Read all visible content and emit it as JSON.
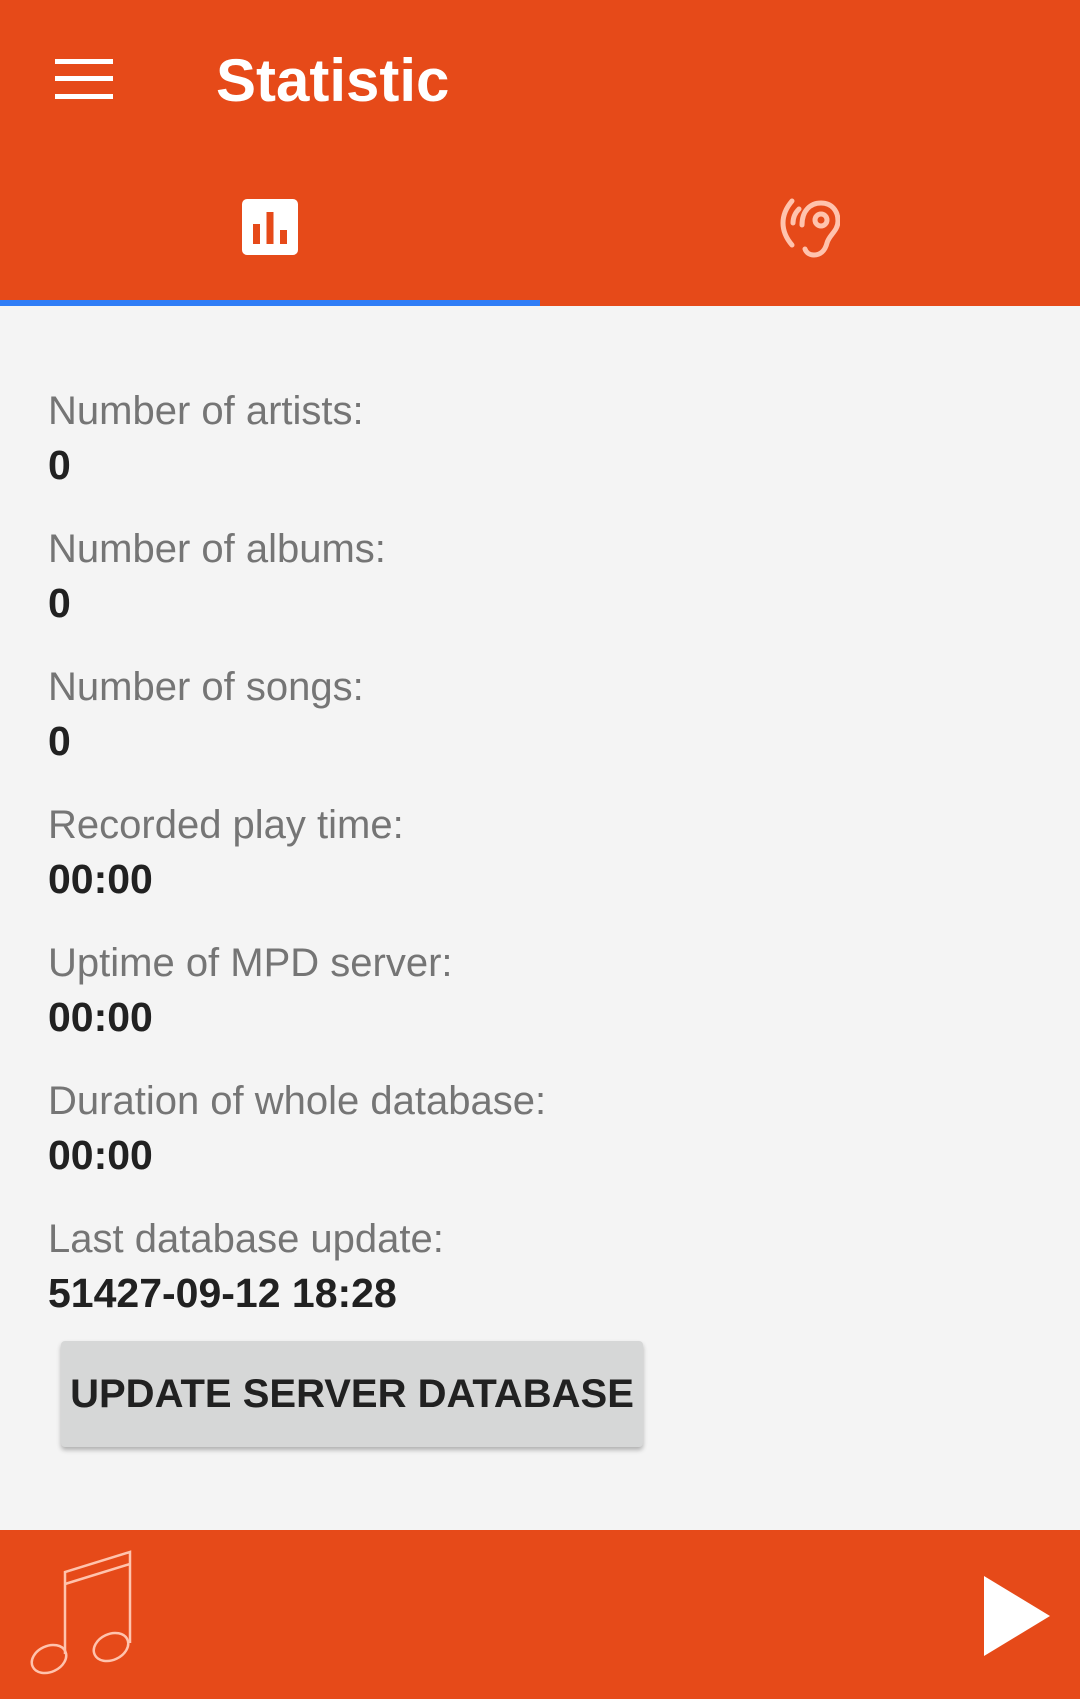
{
  "app": {
    "title": "Statistic"
  },
  "toolbar": {
    "menu_icon": "menu-icon"
  },
  "tabs": [
    {
      "icon": "bar-chart-icon",
      "selected": true
    },
    {
      "icon": "hearing-icon",
      "selected": false
    }
  ],
  "stats": [
    {
      "label": "Number of artists:",
      "value": "0"
    },
    {
      "label": "Number of albums:",
      "value": "0"
    },
    {
      "label": "Number of songs:",
      "value": "0"
    },
    {
      "label": "Recorded play time:",
      "value": "00:00"
    },
    {
      "label": "Uptime of MPD server:",
      "value": "00:00"
    },
    {
      "label": "Duration of whole database:",
      "value": "00:00"
    },
    {
      "label": "Last database update:",
      "value": "51427-09-12 18:28"
    }
  ],
  "actions": {
    "update_label": "UPDATE SERVER DATABASE"
  },
  "player": {
    "art_icon": "music-note-icon",
    "play_icon": "play-icon"
  },
  "colors": {
    "primary": "#e64a19",
    "tab_indicator": "#2f7df6",
    "background": "#f4f4f4",
    "button": "#d6d7d7"
  }
}
